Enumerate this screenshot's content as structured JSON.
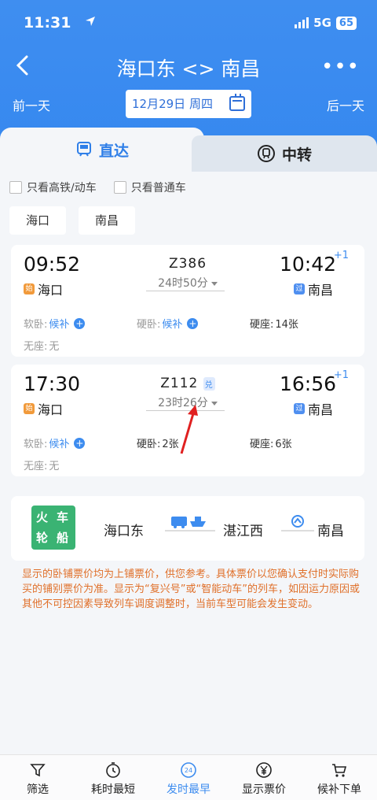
{
  "status": {
    "time": "11:31",
    "network": "5G",
    "battery": "65"
  },
  "nav": {
    "title": "海口东 <> 南昌",
    "more": "•••"
  },
  "datebar": {
    "prev_label": "前一天",
    "next_label": "后一天",
    "date": "12月29日 周四"
  },
  "tabs": {
    "direct": "直达",
    "transfer": "中转"
  },
  "filters": {
    "hsr_only": "只看高铁/动车",
    "regular_only": "只看普通车"
  },
  "station_chips": [
    "海口",
    "南昌"
  ],
  "trains": [
    {
      "dep_time": "09:52",
      "train_no": "Z386",
      "duration": "24时50分",
      "arr_time": "10:42",
      "day_offset": "+1",
      "from": "海口",
      "from_badge": "始",
      "to": "南昌",
      "to_badge": "过",
      "seats": [
        {
          "name": "软卧:",
          "value": "候补"
        },
        {
          "name": "硬卧:",
          "value": "候补"
        },
        {
          "name": "硬座:",
          "value": "14张"
        },
        {
          "name": "无座:",
          "value": "无"
        }
      ]
    },
    {
      "dep_time": "17:30",
      "train_no": "Z112",
      "train_badge": "兑",
      "duration": "23时26分",
      "arr_time": "16:56",
      "day_offset": "+1",
      "from": "海口",
      "from_badge": "始",
      "to": "南昌",
      "to_badge": "过",
      "seats": [
        {
          "name": "软卧:",
          "value": "候补"
        },
        {
          "name": "硬卧:",
          "value": "2张"
        },
        {
          "name": "硬座:",
          "value": "6张"
        },
        {
          "name": "无座:",
          "value": "无"
        }
      ]
    }
  ],
  "combo": {
    "logo": [
      "火",
      "车",
      "轮",
      "船"
    ],
    "stations": [
      "海口东",
      "湛江西",
      "南昌"
    ]
  },
  "notice": "显示的卧铺票价均为上铺票价，供您参考。具体票价以您确认支付时实际购买的铺别票价为准。显示为“复兴号”或“智能动车”的列车，如因运力原因或其他不可控因素导致列车调度调整时，当前车型可能会发生变动。",
  "bottom": [
    {
      "label": "筛选",
      "icon": "filter-icon"
    },
    {
      "label": "耗时最短",
      "icon": "timer-icon"
    },
    {
      "label": "发时最早",
      "icon": "clock-24-icon",
      "active": true,
      "icon_text": "24"
    },
    {
      "label": "显示票价",
      "icon": "yen-icon"
    },
    {
      "label": "候补下单",
      "icon": "cart-icon"
    }
  ],
  "colors": {
    "brand_blue": "#3d8cef",
    "notice_orange": "#e0702a",
    "combo_green": "#3ab373"
  }
}
